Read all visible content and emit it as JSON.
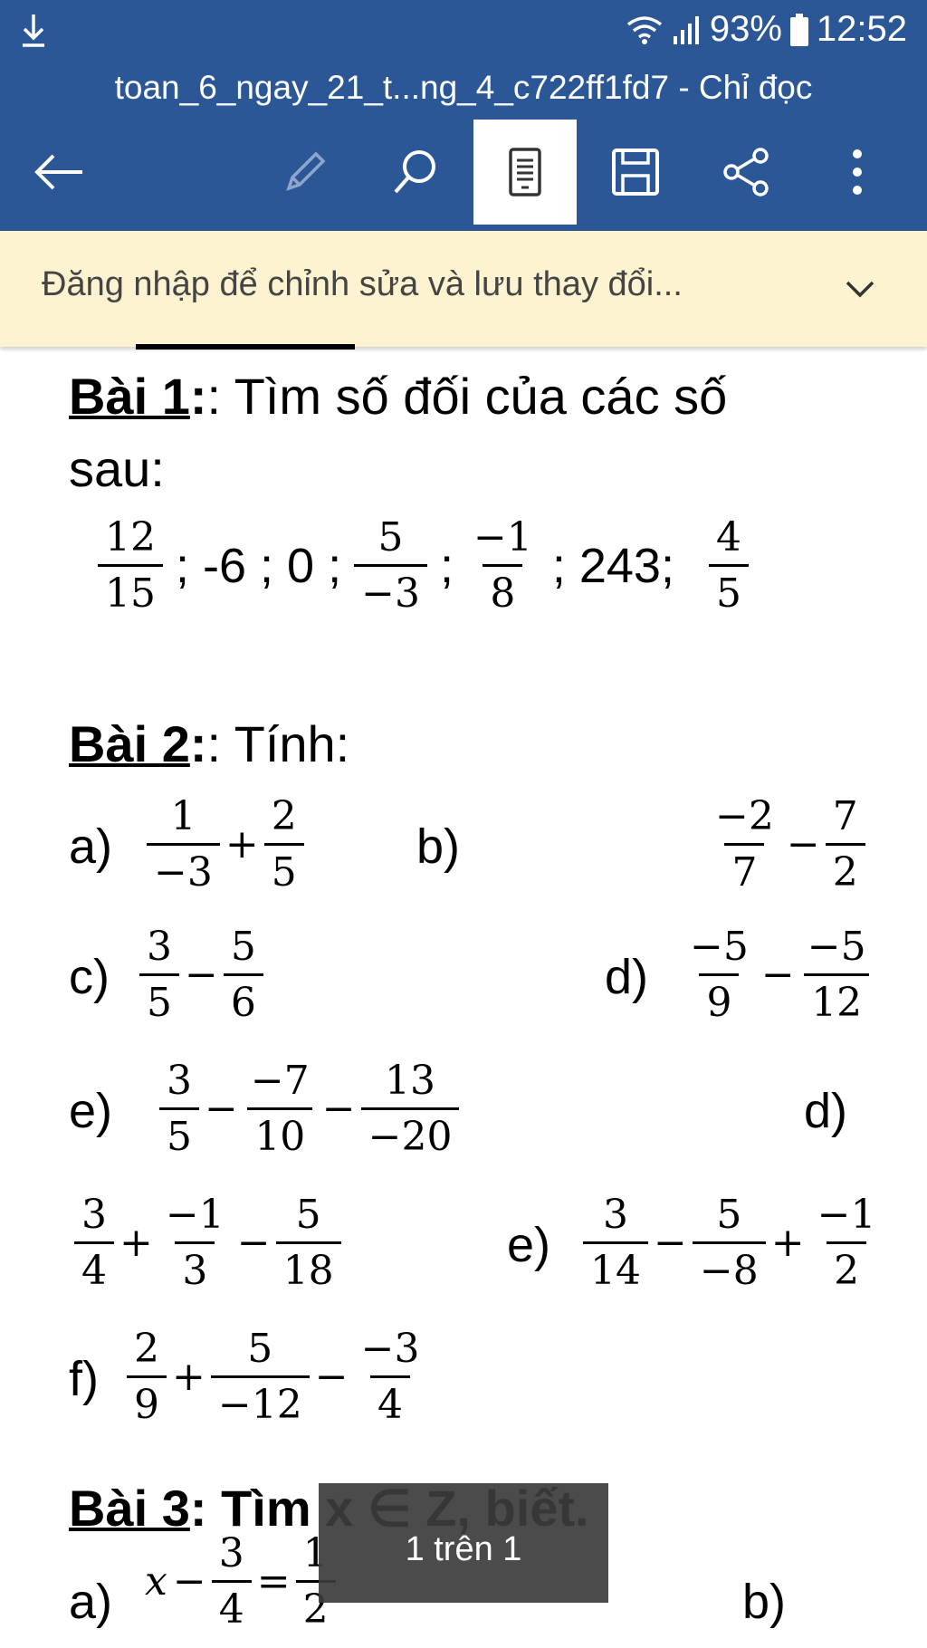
{
  "status_bar": {
    "download_icon": "download-arrow-icon",
    "wifi_icon": "wifi-icon",
    "signal_icon": "signal-bars-icon",
    "battery_percent": "93%",
    "battery_icon": "battery-icon",
    "time": "12:52"
  },
  "window": {
    "title": "toan_6_ngay_21_t...ng_4_c722ff1fd7 - Chỉ đọc"
  },
  "toolbar": {
    "back_icon": "back-arrow-icon",
    "edit_icon": "pencil-icon",
    "search_icon": "search-icon",
    "mobile_view_icon": "mobile-view-icon",
    "save_icon": "save-icon",
    "share_icon": "share-icon",
    "more_icon": "more-vertical-icon"
  },
  "banner": {
    "text": "Đăng nhập để chỉnh sửa và lưu thay đổi...",
    "chevron_icon": "chevron-down-icon"
  },
  "colors": {
    "appbar": "#2b5797",
    "banner": "#fdf3d0",
    "page_indicator": "#3c3c3c"
  },
  "document": {
    "bai1": {
      "label": "Bài 1",
      "rest": ": Tìm số đối của các số",
      "cont": "sau:"
    },
    "bai1_numbers": {
      "f1n": "12",
      "f1d": "15",
      "s1": "; -6 ; 0 ;",
      "f2n": "5",
      "f2d": "−3",
      "s2": ";",
      "f3n": "−1",
      "f3d": "8",
      "s3": "; 243;",
      "f4n": "4",
      "f4d": "5"
    },
    "bai2": {
      "label": "Bài 2",
      "rest": ": Tính:"
    },
    "bai2_a": {
      "label": "a)",
      "f1n": "1",
      "f1d": "−3",
      "op1": "+",
      "f2n": "2",
      "f2d": "5"
    },
    "bai2_b": {
      "label": "b)",
      "f1n": "−2",
      "f1d": "7",
      "op1": "−",
      "f2n": "7",
      "f2d": "2"
    },
    "bai2_c": {
      "label": "c)",
      "f1n": "3",
      "f1d": "5",
      "op1": "−",
      "f2n": "5",
      "f2d": "6"
    },
    "bai2_d": {
      "label": "d)",
      "f1n": "−5",
      "f1d": "9",
      "op1": "−",
      "f2n": "−5",
      "f2d": "12"
    },
    "bai2_e": {
      "label": "e)",
      "f1n": "3",
      "f1d": "5",
      "op1": "−",
      "f2n": "−7",
      "f2d": "10",
      "op2": "−",
      "f3n": "13",
      "f3d": "−20"
    },
    "bai2_d2": {
      "label": "d)",
      "f1n": "3",
      "f1d": "4",
      "op1": "+",
      "f2n": "−1",
      "f2d": "3",
      "op2": "−",
      "f3n": "5",
      "f3d": "18"
    },
    "bai2_e2": {
      "label": "e)",
      "f1n": "3",
      "f1d": "14",
      "op1": "−",
      "f2n": "5",
      "f2d": "−8",
      "op2": "+",
      "f3n": "−1",
      "f3d": "2"
    },
    "bai2_f": {
      "label": "f)",
      "f1n": "2",
      "f1d": "9",
      "op1": "+",
      "f2n": "5",
      "f2d": "−12",
      "op2": "−",
      "f3n": "−3",
      "f3d": "4"
    },
    "bai3": {
      "label": "Bài 3",
      "rest": ": Tìm x ∈ Z, biết."
    },
    "bai3_a": {
      "label": "a)",
      "var": "x",
      "op1": "−",
      "f1n": "3",
      "f1d": "4",
      "eq": "=",
      "f2n": "1",
      "f2d": "2"
    },
    "bai3_b": {
      "label": "b)"
    }
  },
  "page_indicator": {
    "text": "1 trên 1"
  }
}
